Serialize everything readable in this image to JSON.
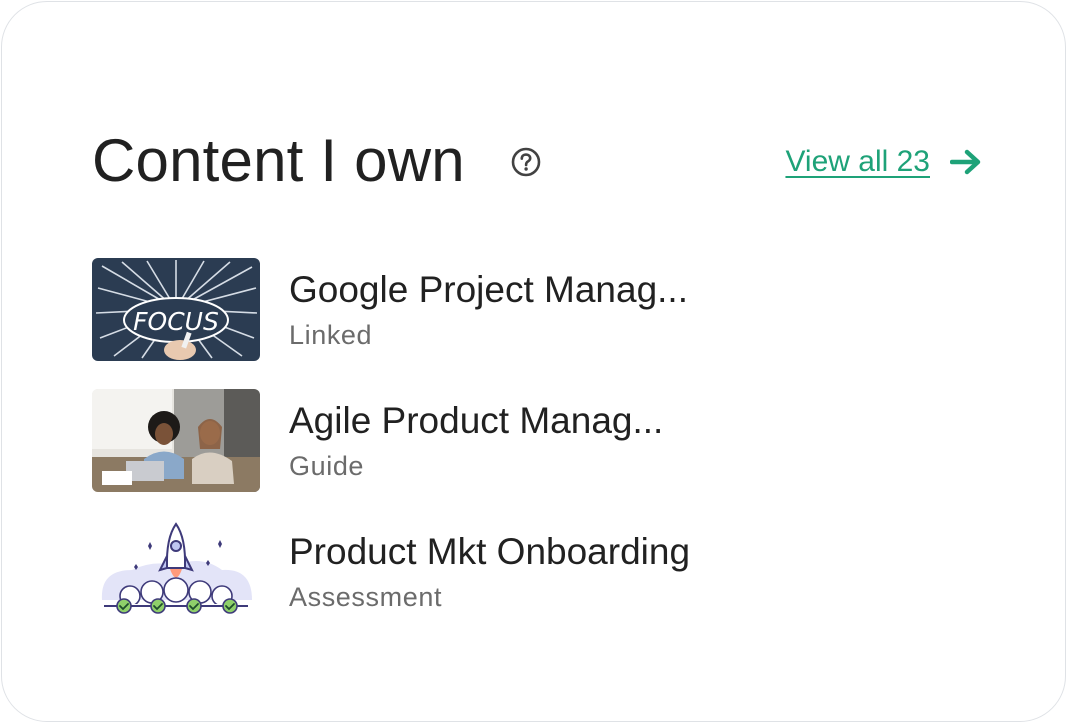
{
  "widget": {
    "title": "Content I own",
    "view_all_label": "View all 23",
    "help_icon": "question-circle-icon",
    "arrow_icon": "arrow-right-icon",
    "accent_color": "#1ea278"
  },
  "items": [
    {
      "title": "Google Project Manag...",
      "type": "Linked",
      "thumbnail": "focus-chalkboard-image"
    },
    {
      "title": "Agile Product Manag...",
      "type": "Guide",
      "thumbnail": "team-meeting-photo"
    },
    {
      "title": "Product Mkt Onboarding",
      "type": "Assessment",
      "thumbnail": "rocket-launch-illustration"
    }
  ]
}
